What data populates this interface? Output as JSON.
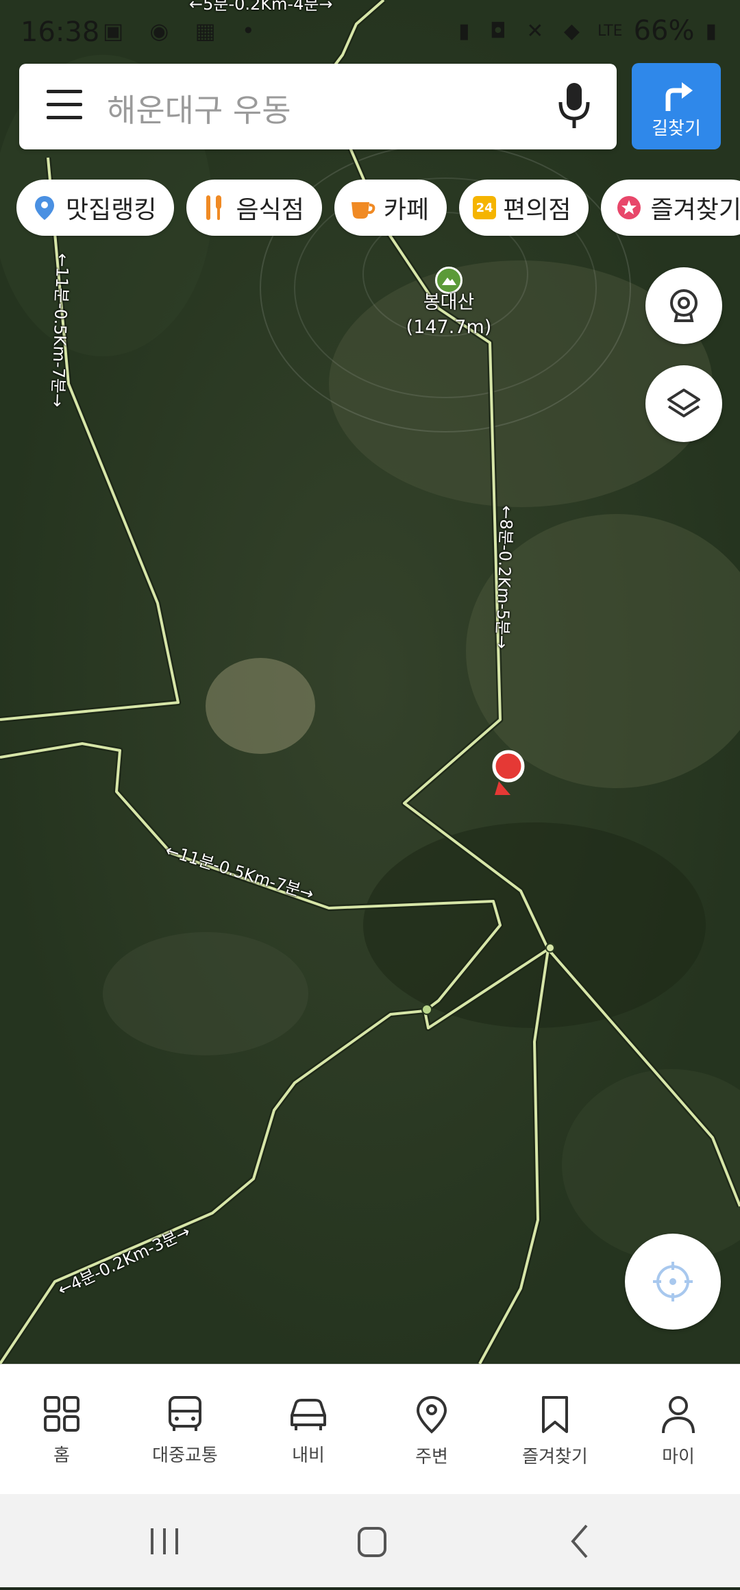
{
  "status": {
    "time": "16:38",
    "battery": "66%",
    "network": "LTE"
  },
  "search": {
    "placeholder": "해운대구 우동",
    "route_label": "길찾기"
  },
  "chips": [
    {
      "label": "맛집랭킹",
      "icon": "map-pin-icon"
    },
    {
      "label": "음식점",
      "icon": "restaurant-icon"
    },
    {
      "label": "카페",
      "icon": "cafe-cup-icon"
    },
    {
      "label": "편의점",
      "icon": "convenience-store-icon",
      "badge": "24"
    },
    {
      "label": "즐겨찾기",
      "icon": "star-icon"
    }
  ],
  "map": {
    "poi": {
      "name": "봉대산",
      "elevation": "(147.7m)"
    },
    "route_labels": [
      "←5분-0.2Km-4분→",
      "←11분-0.5Km-7분→",
      "←8분-0.2Km-5분→",
      "←11분-0.5Km-7분→",
      "←4분-0.2Km-3분→"
    ]
  },
  "bottom_nav": [
    {
      "label": "홈",
      "icon": "home-grid-icon"
    },
    {
      "label": "대중교통",
      "icon": "bus-icon"
    },
    {
      "label": "내비",
      "icon": "car-icon"
    },
    {
      "label": "주변",
      "icon": "location-pin-icon"
    },
    {
      "label": "즐겨찾기",
      "icon": "bookmark-icon"
    },
    {
      "label": "마이",
      "icon": "person-icon"
    }
  ],
  "colors": {
    "accent": "#2f88ea",
    "trail": "#d7e6a8",
    "marker": "#e53935"
  }
}
